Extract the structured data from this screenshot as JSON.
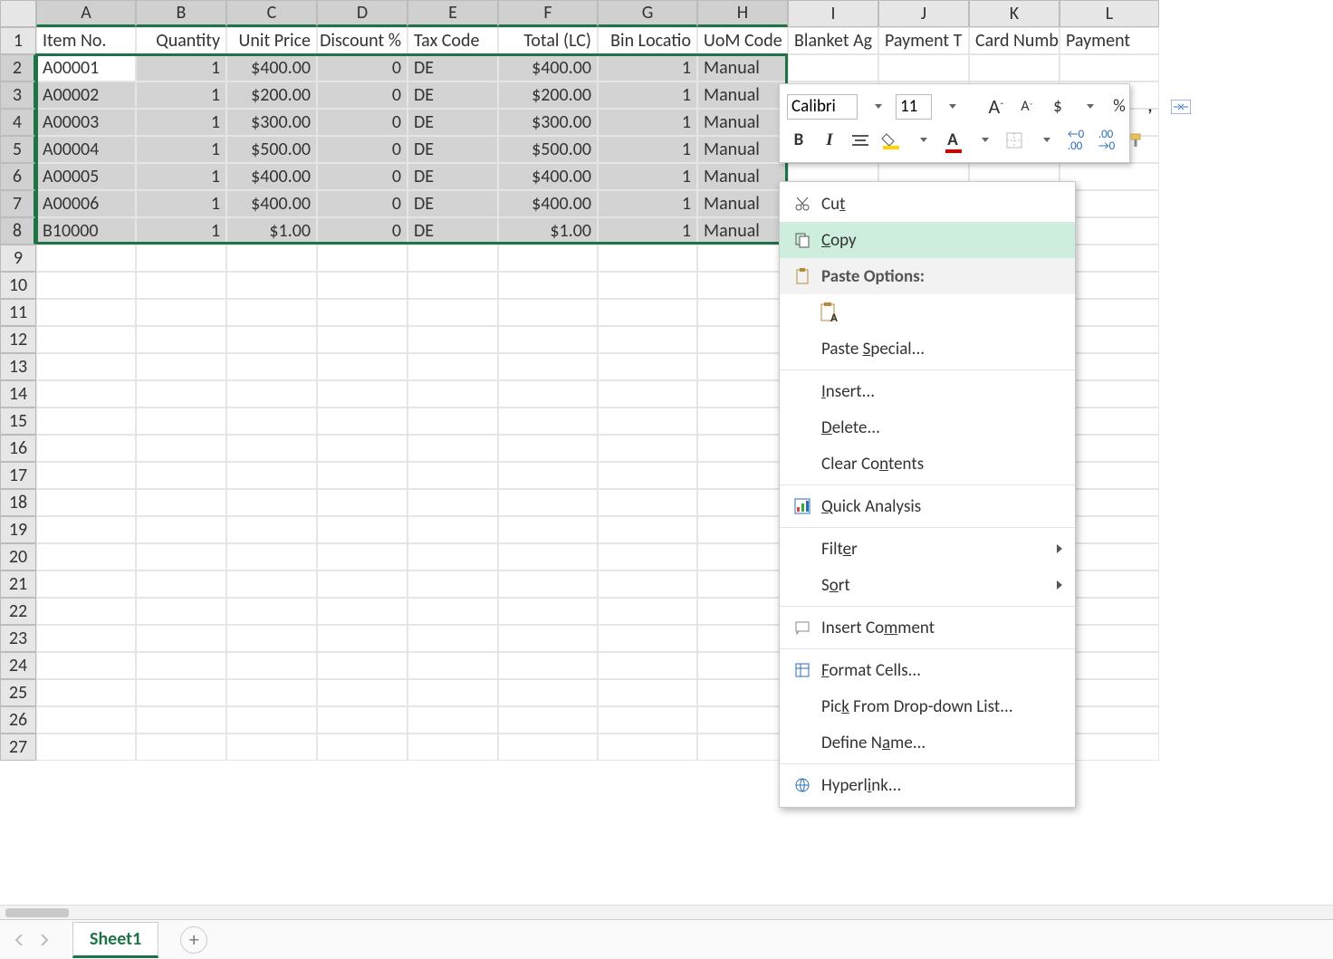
{
  "columns": [
    "A",
    "B",
    "C",
    "D",
    "E",
    "F",
    "G",
    "H",
    "I",
    "J",
    "K",
    "L"
  ],
  "row_count": 27,
  "selected_cols": 8,
  "selected_rows": {
    "from": 2,
    "to": 8
  },
  "headers": [
    "Item No.",
    "Quantity",
    "Unit Price",
    "Discount %",
    "Tax Code",
    "Total (LC)",
    "Bin Locatio",
    "UoM Code",
    "Blanket Ag",
    "Payment T",
    "Card Numb",
    "Payment"
  ],
  "data_rows": [
    [
      "A00001",
      "1",
      "$400.00",
      "0",
      "DE",
      "$400.00",
      "1",
      "Manual"
    ],
    [
      "A00002",
      "1",
      "$200.00",
      "0",
      "DE",
      "$200.00",
      "1",
      "Manual"
    ],
    [
      "A00003",
      "1",
      "$300.00",
      "0",
      "DE",
      "$300.00",
      "1",
      "Manual"
    ],
    [
      "A00004",
      "1",
      "$500.00",
      "0",
      "DE",
      "$500.00",
      "1",
      "Manual"
    ],
    [
      "A00005",
      "1",
      "$400.00",
      "0",
      "DE",
      "$400.00",
      "1",
      "Manual"
    ],
    [
      "A00006",
      "1",
      "$400.00",
      "0",
      "DE",
      "$400.00",
      "1",
      "Manual"
    ],
    [
      "B10000",
      "1",
      "$1.00",
      "0",
      "DE",
      "$1.00",
      "1",
      "Manual"
    ]
  ],
  "numeric_cols": [
    1,
    2,
    3,
    5,
    6
  ],
  "mini_toolbar": {
    "font_name": "Calibri",
    "font_size": "11",
    "bold": "B",
    "italic": "I"
  },
  "context_menu": {
    "cut": "Cut",
    "copy": "Copy",
    "paste_options": "Paste Options:",
    "paste_special": "Paste Special...",
    "insert": "Insert...",
    "delete": "Delete...",
    "clear": "Clear Contents",
    "quick": "Quick Analysis",
    "filter": "Filter",
    "sort": "Sort",
    "comment": "Insert Comment",
    "format": "Format Cells...",
    "pick": "Pick From Drop-down List...",
    "define": "Define Name...",
    "hyperlink": "Hyperlink..."
  },
  "sheet_tab": "Sheet1"
}
